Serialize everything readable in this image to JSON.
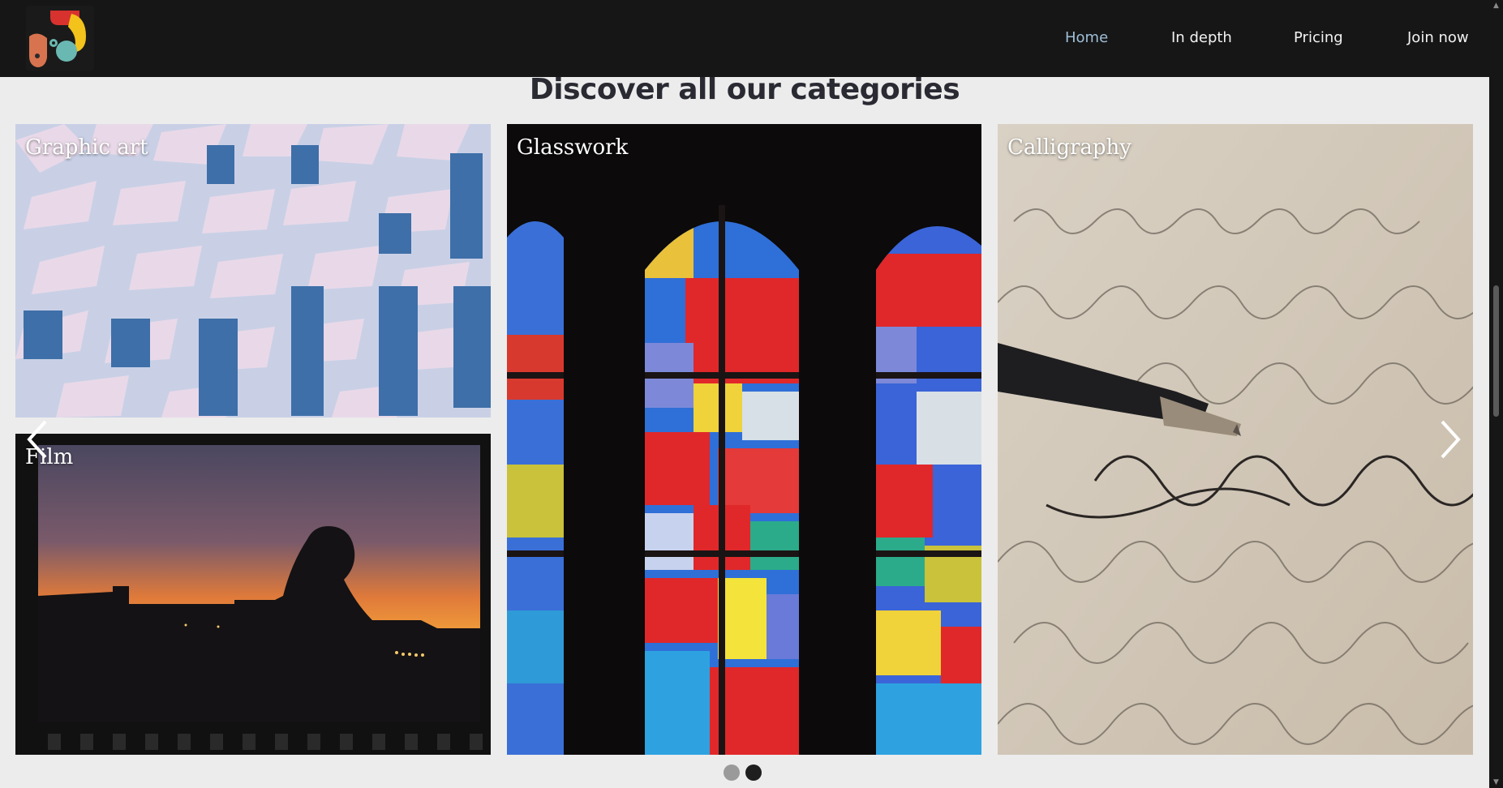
{
  "nav": {
    "links": [
      {
        "label": "Home",
        "active": true
      },
      {
        "label": "In depth",
        "active": false
      },
      {
        "label": "Pricing",
        "active": false
      },
      {
        "label": "Join now",
        "active": false
      }
    ]
  },
  "section": {
    "title": "Discover all our categories"
  },
  "categories": [
    {
      "label": "Graphic art",
      "image": "blue-white facade pattern"
    },
    {
      "label": "Film",
      "image": "sunset silhouette on film frame"
    },
    {
      "label": "Glasswork",
      "image": "stained glass windows"
    },
    {
      "label": "Calligraphy",
      "image": "fountain pen on script paper"
    }
  ],
  "carousel": {
    "prev_icon": "chevron-left-icon",
    "next_icon": "chevron-right-icon",
    "slide_count": 2,
    "active_slide": 2
  },
  "colors": {
    "nav_bg": "#161616",
    "nav_active": "#9fbfd8",
    "page_bg": "#ececec",
    "title": "#2a2a33"
  }
}
